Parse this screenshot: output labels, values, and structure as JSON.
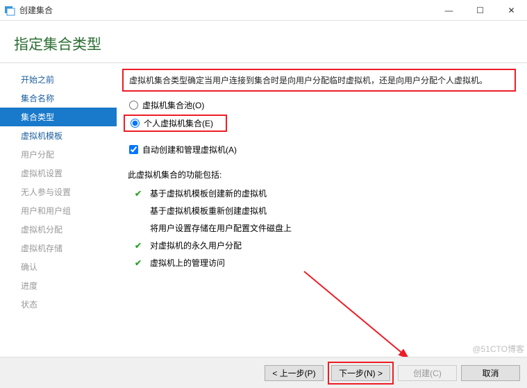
{
  "window": {
    "title": "创建集合",
    "minimize": "—",
    "maximize": "☐",
    "close": "✕"
  },
  "page_heading": "指定集合类型",
  "sidebar": {
    "items": [
      {
        "label": "开始之前",
        "enabled": true
      },
      {
        "label": "集合名称",
        "enabled": true
      },
      {
        "label": "集合类型",
        "enabled": true,
        "active": true
      },
      {
        "label": "虚拟机模板",
        "enabled": true
      },
      {
        "label": "用户分配",
        "enabled": false
      },
      {
        "label": "虚拟机设置",
        "enabled": false
      },
      {
        "label": "无人参与设置",
        "enabled": false
      },
      {
        "label": "用户和用户组",
        "enabled": false
      },
      {
        "label": "虚拟机分配",
        "enabled": false
      },
      {
        "label": "虚拟机存储",
        "enabled": false
      },
      {
        "label": "确认",
        "enabled": false
      },
      {
        "label": "进度",
        "enabled": false
      },
      {
        "label": "状态",
        "enabled": false
      }
    ]
  },
  "main": {
    "description": "虚拟机集合类型确定当用户连接到集合时是向用户分配临时虚拟机，还是向用户分配个人虚拟机。",
    "radio_pool": "虚拟机集合池(O)",
    "radio_personal": "个人虚拟机集合(E)",
    "checkbox_auto": "自动创建和管理虚拟机(A)",
    "features_heading": "此虚拟机集合的功能包括:",
    "features": [
      {
        "checked": true,
        "text": "基于虚拟机模板创建新的虚拟机"
      },
      {
        "checked": false,
        "text": "基于虚拟机模板重新创建虚拟机"
      },
      {
        "checked": false,
        "text": "将用户设置存储在用户配置文件磁盘上"
      },
      {
        "checked": true,
        "text": "对虚拟机的永久用户分配"
      },
      {
        "checked": true,
        "text": "虚拟机上的管理访问"
      }
    ]
  },
  "footer": {
    "prev": "< 上一步(P)",
    "next": "下一步(N) >",
    "create": "创建(C)",
    "cancel": "取消"
  },
  "watermark": "@51CTO博客"
}
